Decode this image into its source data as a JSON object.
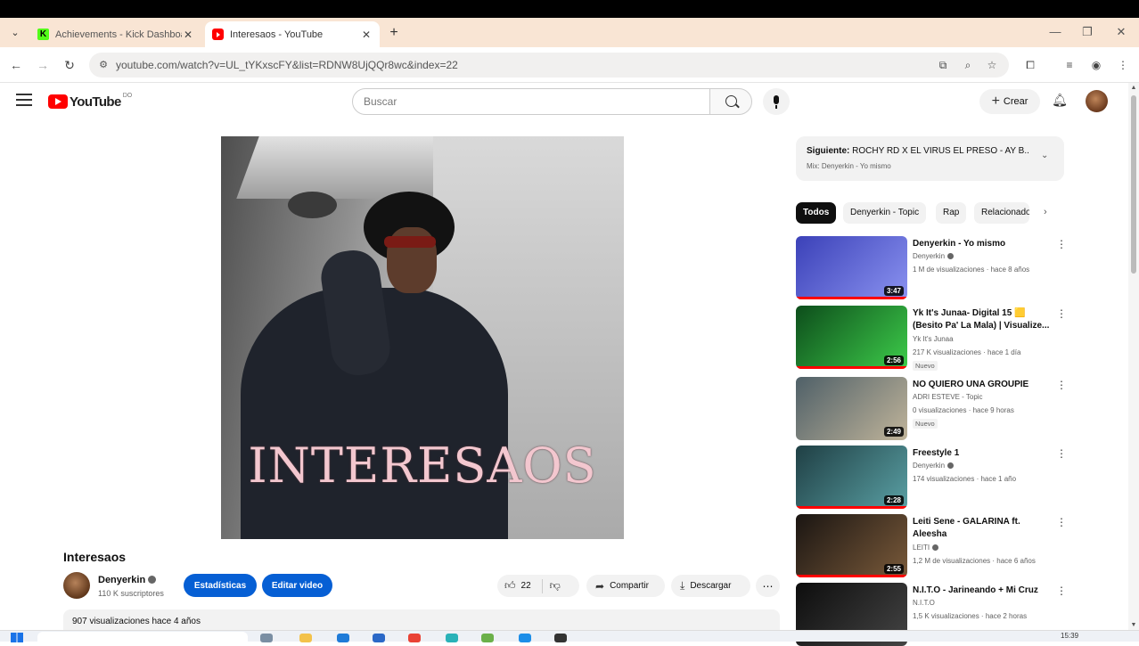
{
  "browser": {
    "tabs": [
      {
        "title": "Achievements - Kick Dashboard",
        "favicon": "kick-icon"
      },
      {
        "title": "Interesaos - YouTube",
        "favicon": "youtube-icon",
        "active": true
      }
    ],
    "url": "youtube.com/watch?v=UL_tYKxscFY&list=RDNW8UjQQr8wc&index=22"
  },
  "youtube": {
    "logo_text": "YouTube",
    "country_code": "DO",
    "search_placeholder": "Buscar",
    "create_label": "Crear"
  },
  "video": {
    "cover_text": "INTERESAOS",
    "title": "Interesaos",
    "channel": "Denyerkin",
    "subscribers": "110 K suscriptores",
    "stats_button": "Estadísticas",
    "edit_button": "Editar video",
    "likes": "22",
    "share_label": "Compartir",
    "download_label": "Descargar",
    "views_meta": "907 visualizaciones  hace 4 años"
  },
  "playlist": {
    "next_label": "Siguiente:",
    "next_title": "ROCHY RD X EL VIRUS EL PRESO - AY B...",
    "mix_label": "Mix: Denyerkin - Yo mismo"
  },
  "chips": [
    "Todos",
    "Denyerkin - Topic",
    "Rap",
    "Relacionado"
  ],
  "recommendations": [
    {
      "title": "Denyerkin - Yo mismo",
      "channel": "Denyerkin",
      "verified": true,
      "views": "1 M de visualizaciones · hace 8 años",
      "duration": "3:47",
      "badge": "",
      "progress": 1.0,
      "colors": [
        "#3b41b8",
        "#8a92f0"
      ]
    },
    {
      "title": "Yk It's Junaa- Digital 15 🟨 (Besito Pa' La Mala) | Visualize...",
      "channel": "Yk It's Junaa",
      "verified": false,
      "views": "217 K visualizaciones · hace 1 día",
      "duration": "2:56",
      "badge": "Nuevo",
      "progress": 1.0,
      "colors": [
        "#0d4d1b",
        "#3dcc4a"
      ]
    },
    {
      "title": "NO QUIERO UNA GROUPIE",
      "channel": "ADRI ESTEVE - Topic",
      "verified": false,
      "views": "0 visualizaciones · hace 9 horas",
      "duration": "2:49",
      "badge": "Nuevo",
      "progress": 0,
      "colors": [
        "#4f6068",
        "#c0b49a"
      ]
    },
    {
      "title": "Freestyle 1",
      "channel": "Denyerkin",
      "verified": true,
      "views": "174 visualizaciones · hace 1 año",
      "duration": "2:28",
      "badge": "",
      "progress": 1.0,
      "colors": [
        "#1f3f44",
        "#5aa0a4"
      ]
    },
    {
      "title": "Leiti Sene - GALARINA ft. Aleesha",
      "channel": "LEITI",
      "verified": true,
      "views": "1,2 M de visualizaciones · hace 6 años",
      "duration": "2:55",
      "badge": "",
      "progress": 1.0,
      "colors": [
        "#1a1512",
        "#7a5a3a"
      ]
    },
    {
      "title": "N.I.T.O - Jarineando + Mi Cruz",
      "channel": "N.I.T.O",
      "verified": false,
      "views": "1,5 K visualizaciones · hace 2 horas",
      "duration": "",
      "badge": "",
      "progress": 0,
      "colors": [
        "#0d0d0d",
        "#444444"
      ]
    }
  ],
  "taskbar": {
    "time": "15:39"
  }
}
